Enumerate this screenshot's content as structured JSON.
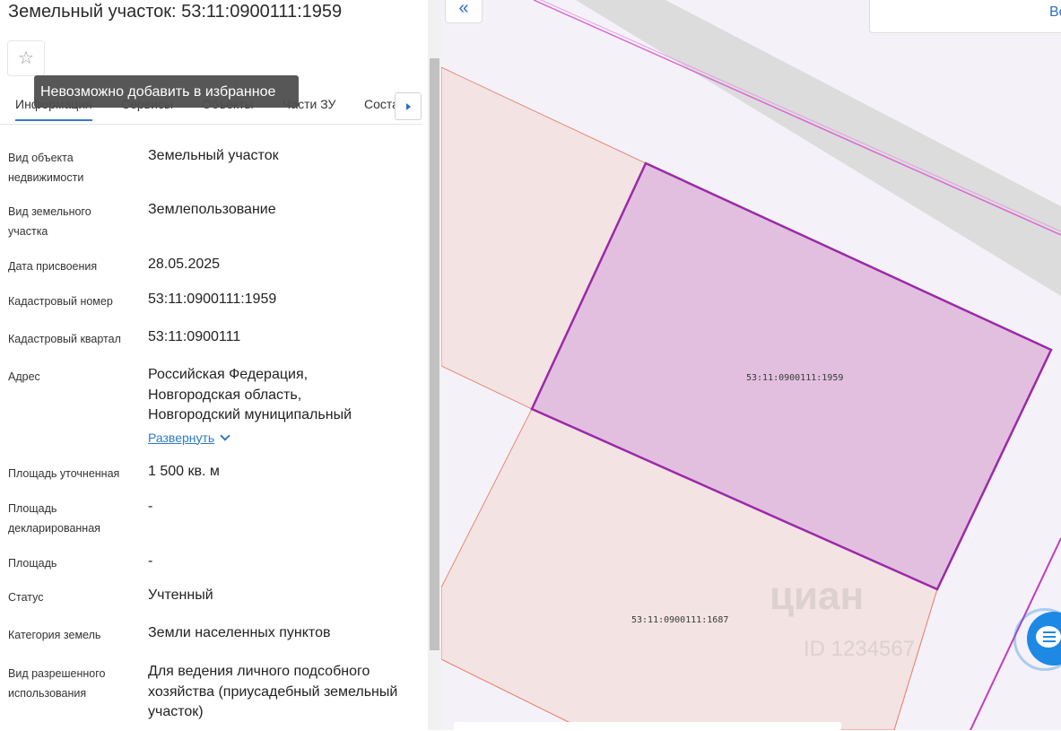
{
  "panel": {
    "title": "Земельный участок: 53:11:0900111:1959",
    "favorite_icon": "star-outline-icon",
    "tooltip": "Невозможно добавить в избранное",
    "tabs": [
      {
        "label": "Информация",
        "active": true
      },
      {
        "label": "Сервисы"
      },
      {
        "label": "Объекты"
      },
      {
        "label": "Части ЗУ"
      },
      {
        "label": "Соста..."
      }
    ],
    "tabs_next_icon": "triangle-right-icon",
    "rows": [
      {
        "label": "Вид объекта недвижимости",
        "value": "Земельный участок"
      },
      {
        "label": "Вид земельного участка",
        "value": "Землепользование"
      },
      {
        "label": "Дата присвоения",
        "value": "28.05.2025"
      },
      {
        "label": "Кадастровый номер",
        "value": "53:11:0900111:1959"
      },
      {
        "label": "Кадастровый квартал",
        "value": "53:11:0900111"
      },
      {
        "label": "Адрес",
        "value_lines": [
          "Российская Федерация,",
          "Новгородская область,",
          "Новгородский муниципальный"
        ],
        "expand_label": "Развернуть"
      },
      {
        "label": "Площадь уточненная",
        "value": "1 500 кв. м"
      },
      {
        "label": "Площадь декларированная",
        "value": "-"
      },
      {
        "label": "Площадь",
        "value": "-"
      },
      {
        "label": "Статус",
        "value": "Учтенный"
      },
      {
        "label": "Категория земель",
        "value": "Земли населенных пунктов"
      },
      {
        "label": "Вид разрешенного использования",
        "value": "Для ведения личного подсобного хозяйства (приусадебный земельный участок)"
      }
    ]
  },
  "map": {
    "collapse_icon": "double-chevron-left-icon",
    "collapse_label": "«",
    "search_text": "Во",
    "selected_parcel": "53:11:0900111:1959",
    "neighbor_parcel": "53:11:0900111:1687",
    "watermark_text": "циан",
    "watermark_sub": "ID 1234567",
    "chat_icon": "chat-bubble-icon",
    "colors": {
      "selected_fill": "#e2bfdf",
      "selected_stroke": "#9a2aa8",
      "neighbor_fill": "#f3e3e3",
      "neighbor_stroke": "#e58a7a",
      "road": "#cfcfcf"
    }
  }
}
